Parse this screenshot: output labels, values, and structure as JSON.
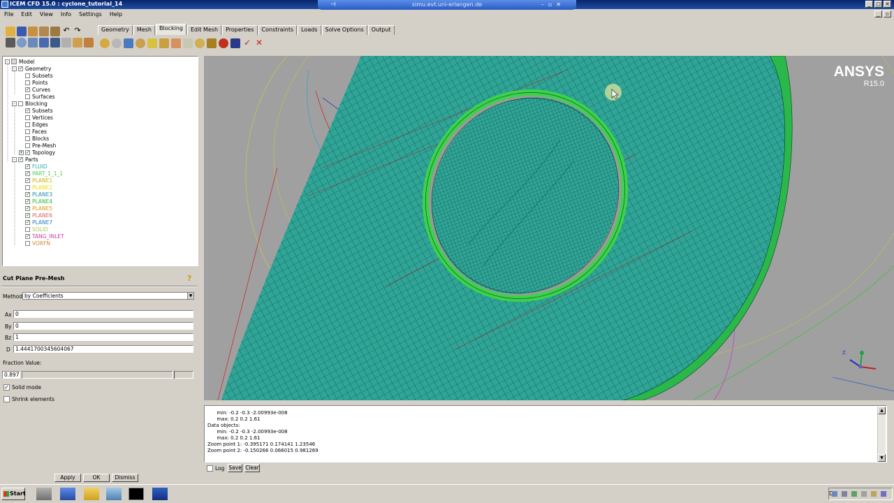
{
  "window": {
    "title": "ICEM CFD 15.0 : cyclone_tutorial_14",
    "remote_host": "simu.evt.uni-erlangen.de"
  },
  "menu": [
    "File",
    "Edit",
    "View",
    "Info",
    "Settings",
    "Help"
  ],
  "tabs": [
    "Geometry",
    "Mesh",
    "Blocking",
    "Edit Mesh",
    "Properties",
    "Constraints",
    "Loads",
    "Solve Options",
    "Output"
  ],
  "active_tab": "Blocking",
  "tree": [
    {
      "label": "Model",
      "level": 0,
      "expander": "-",
      "checked": null,
      "color": "#000000"
    },
    {
      "label": "Geometry",
      "level": 1,
      "expander": "-",
      "checked": true,
      "color": "#000000"
    },
    {
      "label": "Subsets",
      "level": 2,
      "expander": "",
      "checked": false,
      "color": "#000000"
    },
    {
      "label": "Points",
      "level": 2,
      "expander": "",
      "checked": false,
      "color": "#000000"
    },
    {
      "label": "Curves",
      "level": 2,
      "expander": "",
      "checked": true,
      "color": "#000000"
    },
    {
      "label": "Surfaces",
      "level": 2,
      "expander": "",
      "checked": false,
      "color": "#000000"
    },
    {
      "label": "Blocking",
      "level": 1,
      "expander": "-",
      "checked": false,
      "color": "#000000"
    },
    {
      "label": "Subsets",
      "level": 2,
      "expander": "",
      "checked": true,
      "color": "#000000"
    },
    {
      "label": "Vertices",
      "level": 2,
      "expander": "",
      "checked": false,
      "color": "#000000"
    },
    {
      "label": "Edges",
      "level": 2,
      "expander": "",
      "checked": false,
      "color": "#000000"
    },
    {
      "label": "Faces",
      "level": 2,
      "expander": "",
      "checked": false,
      "color": "#000000"
    },
    {
      "label": "Blocks",
      "level": 2,
      "expander": "",
      "checked": false,
      "color": "#000000"
    },
    {
      "label": "Pre-Mesh",
      "level": 2,
      "expander": "",
      "checked": false,
      "color": "#000000"
    },
    {
      "label": "Topology",
      "level": 2,
      "expander": "+",
      "checked": true,
      "color": "#000000"
    },
    {
      "label": "Parts",
      "level": 1,
      "expander": "-",
      "checked": true,
      "color": "#000000"
    },
    {
      "label": "FLUID",
      "level": 2,
      "expander": "",
      "checked": true,
      "color": "#2aa8a8"
    },
    {
      "label": "PART_1_1_1",
      "level": 2,
      "expander": "",
      "checked": true,
      "color": "#4ec84e"
    },
    {
      "label": "PLANE1",
      "level": 2,
      "expander": "",
      "checked": true,
      "color": "#c8b400"
    },
    {
      "label": "PLANE2",
      "level": 2,
      "expander": "",
      "checked": false,
      "color": "#e8e000"
    },
    {
      "label": "PLANE3",
      "level": 2,
      "expander": "",
      "checked": true,
      "color": "#1e8cb4"
    },
    {
      "label": "PLANE4",
      "level": 2,
      "expander": "",
      "checked": true,
      "color": "#2eb82e"
    },
    {
      "label": "PLANE5",
      "level": 2,
      "expander": "",
      "checked": true,
      "color": "#d89a10"
    },
    {
      "label": "PLANE6",
      "level": 2,
      "expander": "",
      "checked": true,
      "color": "#d86060"
    },
    {
      "label": "PLANE7",
      "level": 2,
      "expander": "",
      "checked": true,
      "color": "#2a78c8"
    },
    {
      "label": "SOLID",
      "level": 2,
      "expander": "",
      "checked": false,
      "color": "#a8c850"
    },
    {
      "label": "TANG_INLET",
      "level": 2,
      "expander": "",
      "checked": true,
      "color": "#c83ca0"
    },
    {
      "label": "VORFN",
      "level": 2,
      "expander": "",
      "checked": false,
      "color": "#d08830"
    }
  ],
  "cut_plane": {
    "title": "Cut Plane Pre-Mesh",
    "method_label": "Method",
    "method_value": "by Coefficients",
    "ax_label": "Ax",
    "ax_value": "0",
    "by_label": "By",
    "by_value": "0",
    "bz_label": "Bz",
    "bz_value": "1",
    "d_label": "D",
    "d_value": "1.4441700345604067",
    "fraction_label": "Fraction Value:",
    "fraction_value": "0.897",
    "solid_mode_label": "Solid mode",
    "solid_mode_checked": true,
    "shrink_label": "Shrink elements",
    "shrink_checked": false,
    "apply_label": "Apply",
    "ok_label": "OK",
    "dismiss_label": "Dismiss"
  },
  "viewport": {
    "logo_brand": "ANSYS",
    "logo_version": "R15.0",
    "mesh_color": "#2fa597",
    "ring_color": "#3bd34a",
    "background": "#a0a0a0"
  },
  "messages": [
    "      min: -0.2 -0.3 -2.00993e-008",
    "      max: 0.2 0.2 1.61",
    "Data objects:",
    "      min: -0.2 -0.3 -2.00993e-008",
    "      max: 0.2 0.2 1.61",
    "Zoom point 1: -0.395171 0.174141 1.23546",
    "Zoom point 2: -0.150266 0.066015 0.981269"
  ],
  "message_controls": {
    "log_label": "Log",
    "save_label": "Save",
    "clear_label": "Clear"
  },
  "taskbar": {
    "start_label": "Start",
    "lang": "DE"
  }
}
